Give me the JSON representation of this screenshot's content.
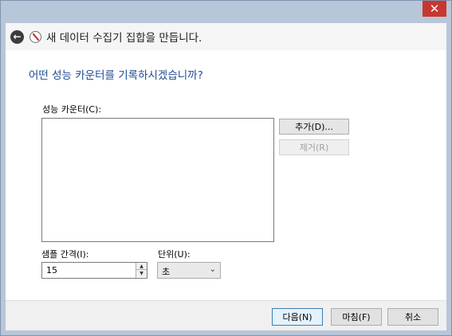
{
  "titlebar": {
    "close_label": "✕"
  },
  "header": {
    "back_icon": "back-arrow-icon",
    "wizard_icon": "performance-wizard-icon",
    "title": "새 데이터 수집기 집합을 만듭니다."
  },
  "main": {
    "question": "어떤 성능 카운터를 기록하시겠습니까?",
    "counters_label": "성능 카운터(C):",
    "counters": [],
    "add_button": "추가(D)...",
    "remove_button": "제거(R)",
    "interval_label": "샘플 간격(I):",
    "interval_value": "15",
    "unit_label": "단위(U):",
    "unit_value": "초"
  },
  "footer": {
    "next_button": "다음(N)",
    "finish_button": "마침(F)",
    "cancel_button": "취소"
  },
  "colors": {
    "frame": "#b7c6d9",
    "close_button": "#c7372f",
    "question_text": "#1f4b93"
  }
}
